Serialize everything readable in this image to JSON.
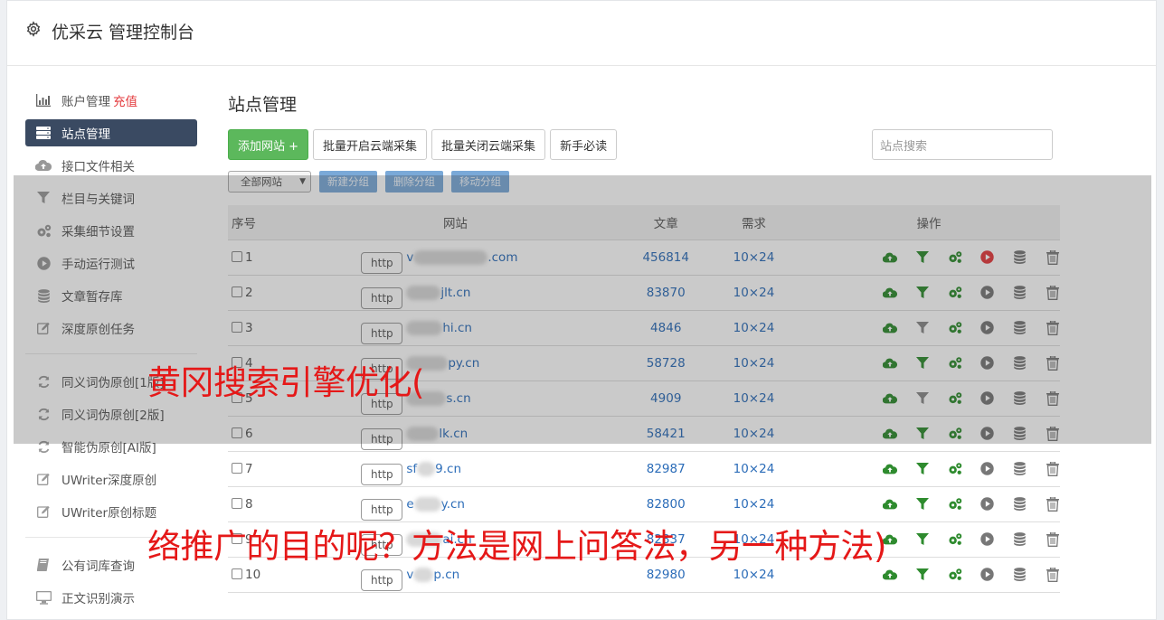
{
  "header": {
    "title": "优采云 管理控制台"
  },
  "sidebar": {
    "items": [
      {
        "label": "账户管理",
        "extra": "充值",
        "icon": "bar-chart-icon"
      },
      {
        "label": "站点管理",
        "icon": "server-icon"
      },
      {
        "label": "接口文件相关",
        "icon": "cloud-upload-icon"
      },
      {
        "label": "栏目与关键词",
        "icon": "filter-icon"
      },
      {
        "label": "采集细节设置",
        "icon": "gears-icon"
      },
      {
        "label": "手动运行测试",
        "icon": "play-icon"
      },
      {
        "label": "文章暂存库",
        "icon": "database-icon"
      },
      {
        "label": "深度原创任务",
        "icon": "edit-icon"
      }
    ],
    "items2": [
      {
        "label": "同义词伪原创[1版]",
        "icon": "refresh-icon"
      },
      {
        "label": "同义词伪原创[2版]",
        "icon": "refresh-icon"
      },
      {
        "label": "智能伪原创[AI版]",
        "icon": "refresh-icon"
      },
      {
        "label": "UWriter深度原创",
        "icon": "edit-icon"
      },
      {
        "label": "UWriter原创标题",
        "icon": "edit-icon"
      }
    ],
    "items3": [
      {
        "label": "公有词库查询",
        "icon": "book-icon"
      },
      {
        "label": "正文识别演示",
        "icon": "monitor-icon"
      }
    ]
  },
  "main": {
    "title": "站点管理",
    "toolbar": {
      "add": "添加网站 +",
      "batch_on": "批量开启云端采集",
      "batch_off": "批量关闭云端采集",
      "guide": "新手必读"
    },
    "search_placeholder": "站点搜索",
    "group_select": "全部网站",
    "group_buttons": {
      "new": "新建分组",
      "delete": "删除分组",
      "move": "移动分组"
    },
    "table": {
      "headers": {
        "seq": "序号",
        "site": "网站",
        "articles": "文章",
        "demand": "需求",
        "ops": "操作"
      },
      "proto": "http",
      "rows": [
        {
          "seq": "1",
          "domain": ".com",
          "prefix": "v",
          "articles": "456814",
          "demand": "10×24",
          "filter_on": true,
          "run_active": true
        },
        {
          "seq": "2",
          "domain": "jlt.cn",
          "prefix": "",
          "articles": "83870",
          "demand": "10×24",
          "filter_on": true,
          "run_active": false
        },
        {
          "seq": "3",
          "domain": "hi.cn",
          "prefix": "",
          "articles": "4846",
          "demand": "10×24",
          "filter_on": false,
          "run_active": false
        },
        {
          "seq": "4",
          "domain": "py.cn",
          "prefix": "",
          "articles": "58728",
          "demand": "10×24",
          "filter_on": true,
          "run_active": false
        },
        {
          "seq": "5",
          "domain": "s.cn",
          "prefix": "",
          "articles": "4909",
          "demand": "10×24",
          "filter_on": false,
          "run_active": false
        },
        {
          "seq": "6",
          "domain": "lk.cn",
          "prefix": "",
          "articles": "58421",
          "demand": "10×24",
          "filter_on": true,
          "run_active": false
        },
        {
          "seq": "7",
          "domain": "9.cn",
          "prefix": "sf",
          "articles": "82987",
          "demand": "10×24",
          "filter_on": true,
          "run_active": false
        },
        {
          "seq": "8",
          "domain": "y.cn",
          "prefix": "e",
          "articles": "82800",
          "demand": "10×24",
          "filter_on": true,
          "run_active": false
        },
        {
          "seq": "9",
          "domain": "ai.cn",
          "prefix": "",
          "articles": "82837",
          "demand": "10×24",
          "filter_on": true,
          "run_active": false
        },
        {
          "seq": "10",
          "domain": "p.cn",
          "prefix": "v",
          "articles": "82980",
          "demand": "10×24",
          "filter_on": true,
          "run_active": false
        }
      ]
    }
  },
  "overlay": {
    "line1": "黄冈搜索引擎优化(",
    "line2": "络推广的目的呢？方法是网上问答法，另一种方法)"
  },
  "colors": {
    "accent_green": "#5cb85c",
    "sidebar_active": "#3a4a62",
    "link_blue": "#2b6cb8",
    "overlay_red": "#e51818"
  }
}
